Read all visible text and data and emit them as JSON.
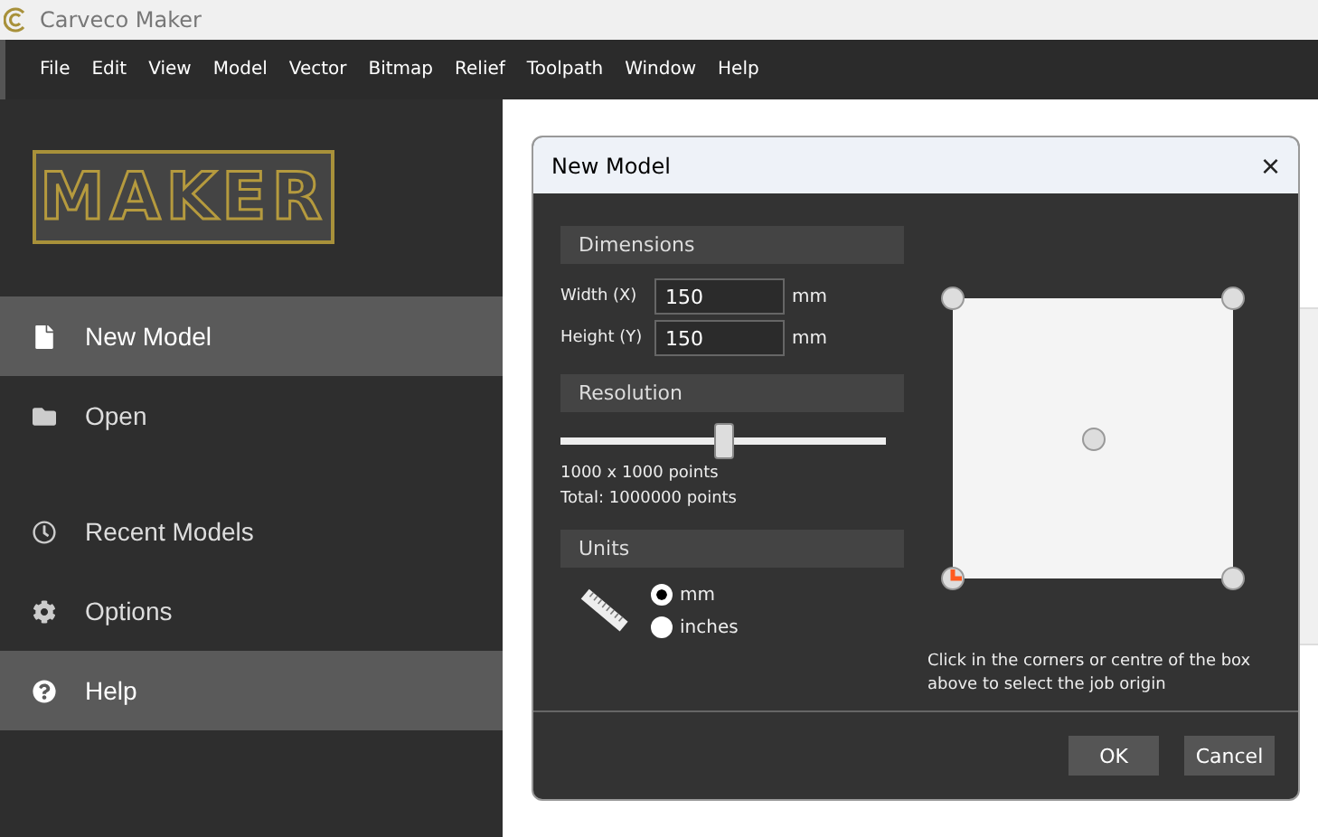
{
  "window": {
    "title": "Carveco Maker"
  },
  "menu": [
    "File",
    "Edit",
    "View",
    "Model",
    "Vector",
    "Bitmap",
    "Relief",
    "Toolpath",
    "Window",
    "Help"
  ],
  "logo": {
    "text": "MAKER"
  },
  "sidebar": {
    "items": [
      {
        "label": "New Model",
        "selected": true
      },
      {
        "label": "Open",
        "selected": false
      },
      {
        "label": "Recent Models",
        "selected": false
      },
      {
        "label": "Options",
        "selected": false
      },
      {
        "label": "Help",
        "selected": true
      }
    ]
  },
  "dialog": {
    "title": "New Model",
    "close": "×",
    "dimensions": {
      "heading": "Dimensions",
      "fields": [
        {
          "label": "Width (X)",
          "value": "150",
          "unit": "mm"
        },
        {
          "label": "Height (Y)",
          "value": "150",
          "unit": "mm"
        }
      ]
    },
    "resolution": {
      "heading": "Resolution",
      "level": 0.5,
      "points": "1000 x 1000 points",
      "total": "Total: 1000000 points"
    },
    "units": {
      "heading": "Units",
      "options": [
        {
          "label": "mm",
          "selected": true
        },
        {
          "label": "inches",
          "selected": false
        }
      ]
    },
    "origin": {
      "points": [
        {
          "selected": false
        },
        {
          "selected": false
        },
        {
          "selected": false
        },
        {
          "selected": true
        },
        {
          "selected": false
        }
      ],
      "hint": "Click in the corners or centre of the box above to select the job origin"
    },
    "buttons": [
      "OK",
      "Cancel"
    ]
  }
}
